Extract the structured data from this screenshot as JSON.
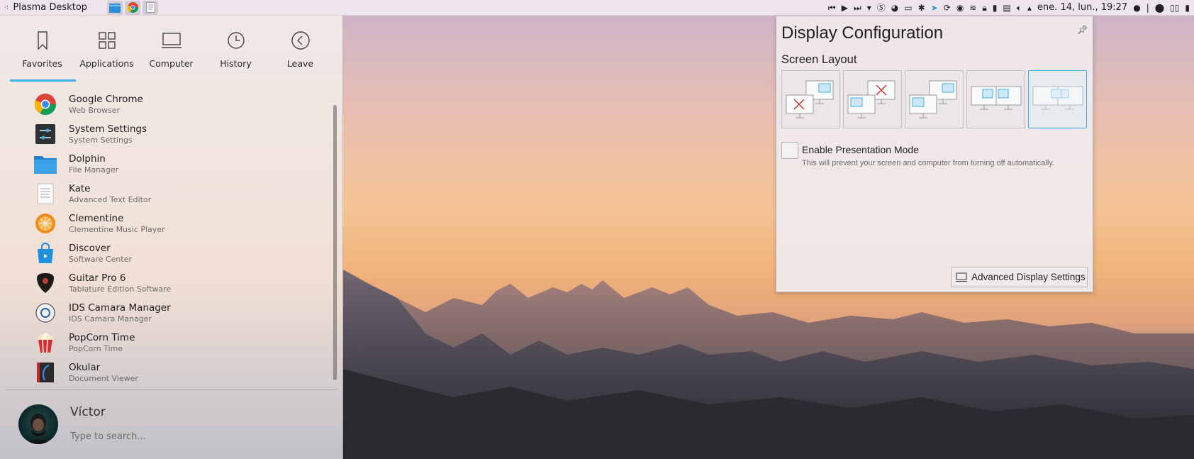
{
  "panel": {
    "app_title": "Plasma Desktop",
    "clock": "ene. 14, lun., 19:27",
    "tasks": [
      "file-manager-icon",
      "chrome-icon",
      "text-editor-icon"
    ],
    "tray_icons": [
      "media-previous-icon",
      "media-play-icon",
      "media-next-icon",
      "media-dropdown-icon",
      "skype-icon",
      "firefox-icon",
      "display-icon",
      "bluetooth-icon",
      "telegram-icon",
      "updates-icon",
      "vpn-icon",
      "wifi-icon",
      "lock-icon",
      "usb-icon",
      "clipboard-icon",
      "volume-icon",
      "tray-expand-icon"
    ]
  },
  "launcher": {
    "tabs": [
      {
        "label": "Favorites",
        "icon": "bookmark-icon"
      },
      {
        "label": "Applications",
        "icon": "grid-icon"
      },
      {
        "label": "Computer",
        "icon": "monitor-icon"
      },
      {
        "label": "History",
        "icon": "clock-icon"
      },
      {
        "label": "Leave",
        "icon": "back-arrow-icon"
      }
    ],
    "apps": [
      {
        "name": "Google Chrome",
        "desc": "Web Browser"
      },
      {
        "name": "System Settings",
        "desc": "System Settings"
      },
      {
        "name": "Dolphin",
        "desc": "File Manager"
      },
      {
        "name": "Kate",
        "desc": "Advanced Text Editor"
      },
      {
        "name": "Clementine",
        "desc": "Clementine Music Player"
      },
      {
        "name": "Discover",
        "desc": "Software Center"
      },
      {
        "name": "Guitar Pro 6",
        "desc": "Tablature Edition Software"
      },
      {
        "name": "IDS Camara Manager",
        "desc": "IDS Camara Manager"
      },
      {
        "name": "PopCorn Time",
        "desc": "PopCorn Time"
      },
      {
        "name": "Okular",
        "desc": "Document Viewer"
      }
    ],
    "user_name": "Víctor",
    "search_placeholder": "Type to search..."
  },
  "display_config": {
    "title": "Display Configuration",
    "screen_layout_label": "Screen Layout",
    "presentation_mode_label": "Enable Presentation Mode",
    "presentation_mode_desc": "This will prevent your screen and computer from turning off automatically.",
    "presentation_mode_checked": false,
    "advanced_button": "Advanced Display Settings",
    "layouts": [
      "external-only",
      "laptop-only",
      "extend-layout",
      "mirror-layout",
      "extend-right-layout"
    ],
    "selected_layout": 5,
    "colors": {
      "accent": "#3daee9"
    }
  }
}
